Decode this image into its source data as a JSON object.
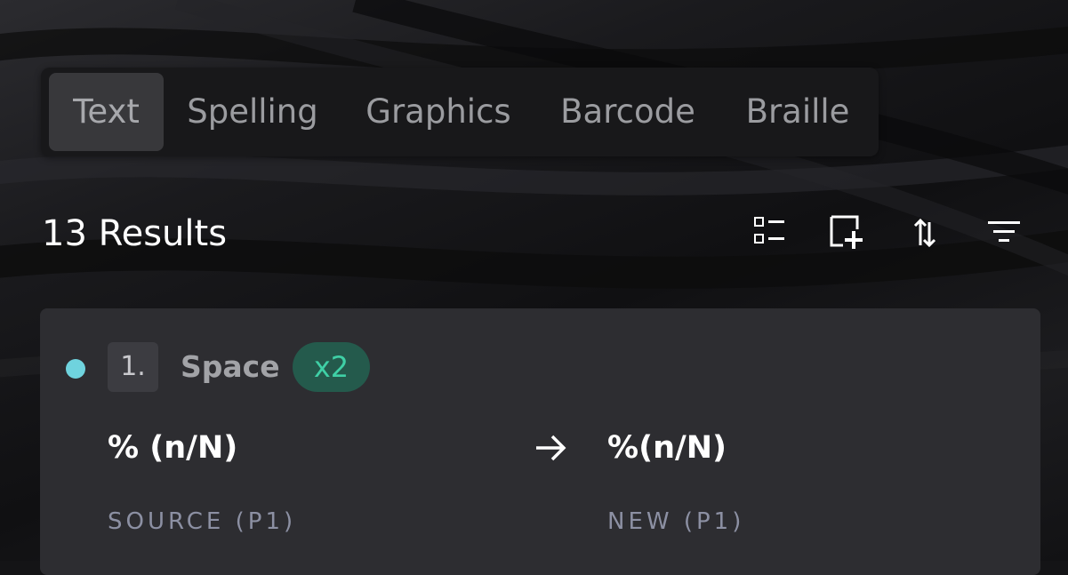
{
  "tabs": [
    {
      "label": "Text",
      "active": true
    },
    {
      "label": "Spelling",
      "active": false
    },
    {
      "label": "Graphics",
      "active": false
    },
    {
      "label": "Barcode",
      "active": false
    },
    {
      "label": "Braille",
      "active": false
    }
  ],
  "results": {
    "count_label": "13 Results"
  },
  "toolbar": {
    "icons": [
      "list-view-icon",
      "add-region-icon",
      "sort-icon",
      "filter-icon"
    ]
  },
  "item": {
    "number": "1.",
    "title": "Space",
    "count": "x2",
    "status_color": "#6fd3de",
    "source_text": "% (n/N)",
    "new_text": "%(n/N)",
    "source_label": "SOURCE (P1)",
    "new_label": "NEW (P1)"
  },
  "colors": {
    "card_bg": "#2d2d31",
    "badge_bg": "#245a4c",
    "badge_text": "#3fd0a6"
  }
}
